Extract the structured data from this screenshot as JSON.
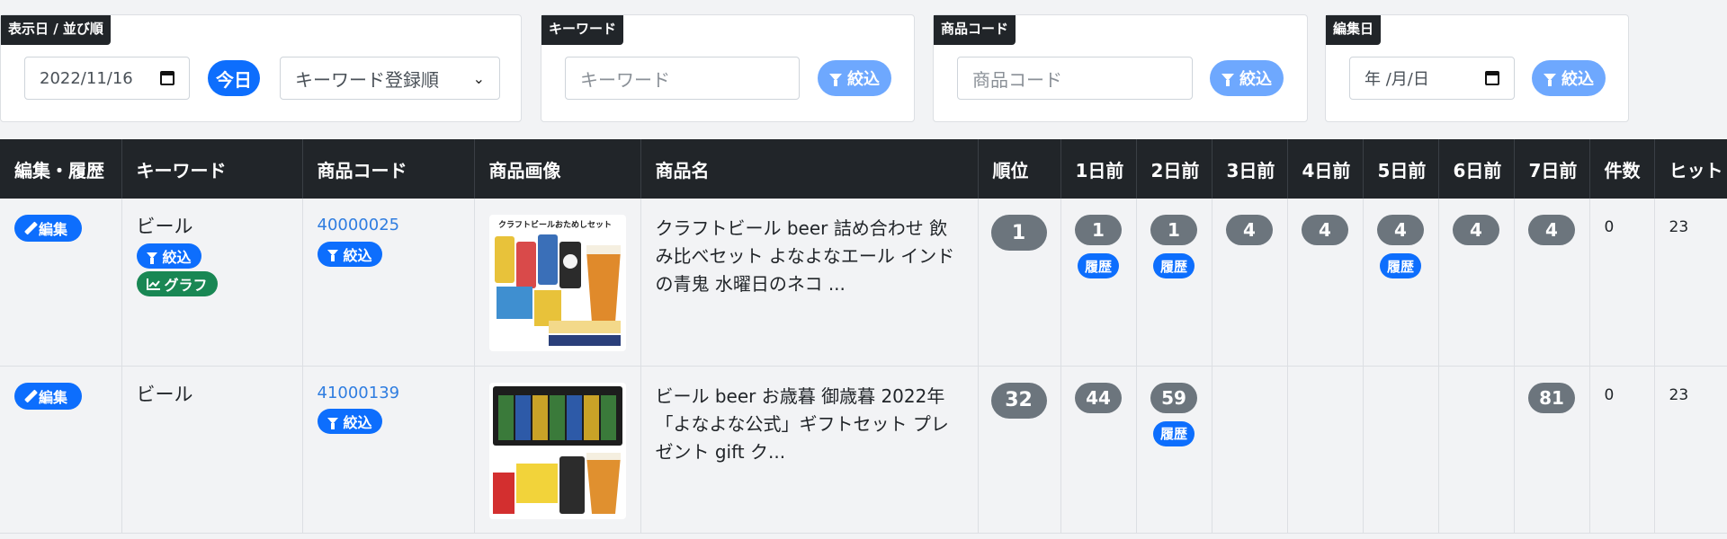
{
  "filters": {
    "date_sort": {
      "label": "表示日 / 並び順",
      "date_value": "2022/11/16",
      "today_label": "今日",
      "sort_value": "キーワード登録順"
    },
    "keyword": {
      "label": "キーワード",
      "placeholder": "キーワード",
      "filter_label": "絞込"
    },
    "product_code": {
      "label": "商品コード",
      "placeholder": "商品コード",
      "filter_label": "絞込"
    },
    "edit_date": {
      "label": "編集日",
      "date_placeholder": "年 /月/日",
      "filter_label": "絞込"
    }
  },
  "table": {
    "headers": [
      "編集・履歴",
      "キーワード",
      "商品コード",
      "商品画像",
      "商品名",
      "順位",
      "1日前",
      "2日前",
      "3日前",
      "4日前",
      "5日前",
      "6日前",
      "7日前",
      "件数",
      "ヒット"
    ],
    "edit_label": "編集",
    "filter_label": "絞込",
    "graph_label": "グラフ",
    "history_label": "履歴",
    "rows": [
      {
        "keyword": "ビール",
        "code": "40000025",
        "name": "クラフトビール beer 詰め合わせ 飲み比べセット よなよなエール インドの青鬼 水曜日のネコ ...",
        "image_caption": "クラフトビールおためしセット",
        "rank": "1",
        "d1": "1",
        "d2": "1",
        "d3": "4",
        "d4": "4",
        "d5": "4",
        "d6": "4",
        "d7": "4",
        "count": "0",
        "hit": "23"
      },
      {
        "keyword": "ビール",
        "code": "41000139",
        "name": "ビール beer お歳暮 御歳暮 2022年「よなよな公式」ギフトセット プレゼント gift ク...",
        "rank": "32",
        "d1": "44",
        "d2": "59",
        "d7": "81",
        "count": "0",
        "hit": "23"
      }
    ]
  },
  "colors": {
    "primary": "#0d6efd",
    "light_primary": "#6ea8fe",
    "dark": "#212529",
    "badge_gray": "#6c757d",
    "success": "#198754",
    "link": "#2f7de0"
  }
}
